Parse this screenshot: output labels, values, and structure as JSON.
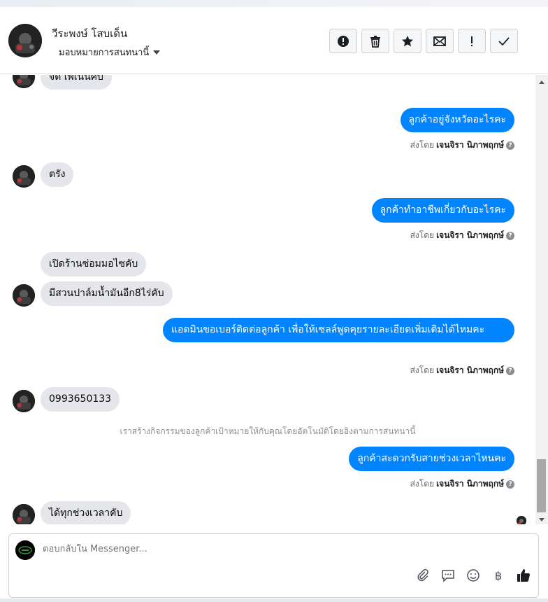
{
  "header": {
    "contact_name": "วีระพงษ์ โสบเด็น",
    "assign_label": "มอบหมายการสนทนานี้",
    "toolbar": [
      {
        "name": "spam-button",
        "icon": "exclamation-circle-icon"
      },
      {
        "name": "delete-button",
        "icon": "trash-icon"
      },
      {
        "name": "star-button",
        "icon": "star-icon"
      },
      {
        "name": "mark-unread-button",
        "icon": "envelope-icon"
      },
      {
        "name": "follow-up-button",
        "icon": "exclamation-icon"
      },
      {
        "name": "mark-done-button",
        "icon": "check-icon"
      }
    ]
  },
  "conversation": {
    "messages": [
      {
        "dir": "in",
        "text": "จัด เพ่เนนคบ"
      },
      {
        "dir": "out",
        "text": "ลูกค้าอยู่จังหวัดอะไรคะ",
        "sent_prefix": "ส่งโดย",
        "sender": "เจนจิรา นิภาพฤกษ์"
      },
      {
        "dir": "in",
        "text": "ตรัง"
      },
      {
        "dir": "out",
        "text": "ลูกค้าทำอาชีพเกี่ยวกับอะไรคะ",
        "sent_prefix": "ส่งโดย",
        "sender": "เจนจิรา นิภาพฤกษ์"
      },
      {
        "dir": "in",
        "text": "เปิดร้านซ่อมมอไซคับ"
      },
      {
        "dir": "in",
        "text": "มีสวนปาล์มน้ำมันอีก8ไร่คับ"
      },
      {
        "dir": "out",
        "text": "แอดมินขอเบอร์ติดต่อลูกค้า เพื่อให้เซลล์พูดคุยรายละเอียดเพิ่มเติมได้ไหมคะ",
        "sent_prefix": "ส่งโดย",
        "sender": "เจนจิรา นิภาพฤกษ์"
      },
      {
        "dir": "in",
        "text": "0993650133"
      },
      {
        "dir": "system",
        "text": "เราสร้างกิจกรรมของลูกค้าเป้าหมายให้กับคุณโดยอัตโนมัติโดยอิงตามการสนทนานี้"
      },
      {
        "dir": "out",
        "text": "ลูกค้าสะดวกรับสายช่วงเวลาไหนคะ",
        "sent_prefix": "ส่งโดย",
        "sender": "เจนจิรา นิภาพฤกษ์"
      },
      {
        "dir": "in",
        "text": "ได้ทุกช่วงเวลาคับ"
      }
    ]
  },
  "composer": {
    "placeholder": "ตอบกลับใน Messenger...",
    "icons": [
      "paperclip-icon",
      "saved-reply-icon",
      "emoji-icon",
      "baht-payment-icon",
      "thumbs-up-icon"
    ]
  },
  "colors": {
    "outgoing_bubble": "#0084ff",
    "incoming_bubble": "#e4e6eb"
  }
}
